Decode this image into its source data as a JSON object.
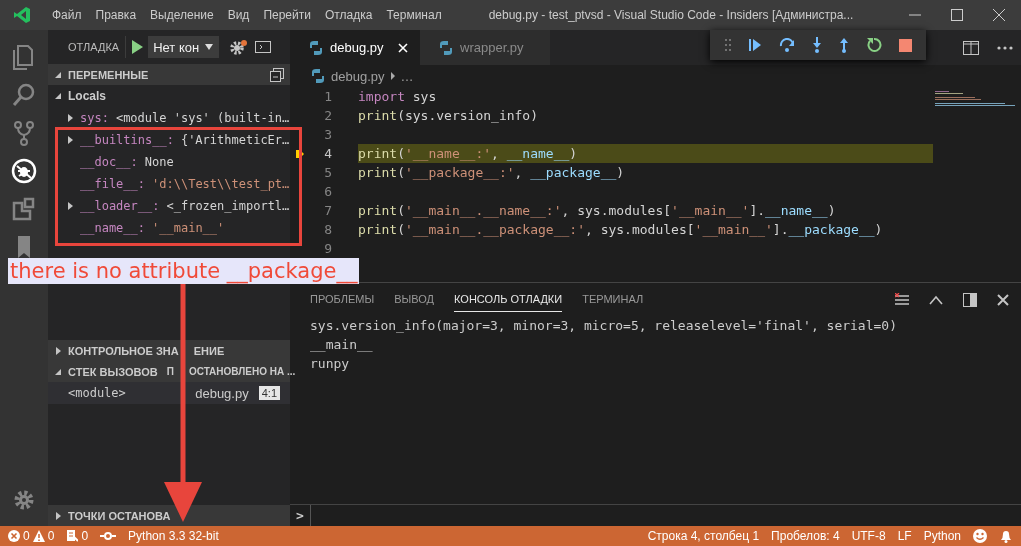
{
  "window": {
    "title": "debug.py - test_ptvsd - Visual Studio Code - Insiders [Администра..."
  },
  "menu": [
    "Файл",
    "Правка",
    "Выделение",
    "Вид",
    "Перейти",
    "Отладка",
    "Терминал"
  ],
  "activity_bar": [
    {
      "kind": "files",
      "selected": false
    },
    {
      "kind": "search",
      "selected": false
    },
    {
      "kind": "scm",
      "selected": false
    },
    {
      "kind": "debug",
      "selected": true
    },
    {
      "kind": "extensions",
      "selected": false
    },
    {
      "kind": "bookmarks",
      "selected": false
    }
  ],
  "debug_header": {
    "title": "ОТЛАДКА",
    "configuration": "Нет кон"
  },
  "variables": {
    "title": "ПЕРЕМЕННЫЕ",
    "expanded": true,
    "scopes": [
      {
        "name": "Locals",
        "expanded": true,
        "children": [
          {
            "name": "sys:",
            "value": "<module 'sys' (built-in…",
            "kind": "object",
            "expandable": true
          },
          {
            "name": "__builtins__:",
            "value": "{'ArithmeticEr…",
            "kind": "object",
            "expandable": true
          },
          {
            "name": "__doc__:",
            "value": "None",
            "kind": "object",
            "expandable": false
          },
          {
            "name": "__file__:",
            "value": "'d:\\\\Test\\\\test_pt…",
            "kind": "string",
            "expandable": false
          },
          {
            "name": "__loader__:",
            "value": "<_frozen_importl…",
            "kind": "object",
            "expandable": true
          },
          {
            "name": "__name__:",
            "value": "'__main__'",
            "kind": "string",
            "expandable": false
          }
        ]
      }
    ]
  },
  "watch": {
    "title_parts": [
      "КОНТРОЛЬНОЕ ЗНА",
      "ЕНИЕ"
    ],
    "expanded": false
  },
  "call_stack": {
    "title": "СТЕК ВЫЗОВОВ",
    "expanded": true,
    "status_parts": [
      "П",
      "ОСТАНОВЛЕНО НА ..."
    ],
    "frames": [
      {
        "name": "<module>",
        "file": "debug.py",
        "position": "4:1"
      }
    ]
  },
  "breakpoints": {
    "title": "ТОЧКИ ОСТАНОВА",
    "expanded": false
  },
  "tabs": [
    {
      "label": "debug.py",
      "selected": true
    },
    {
      "label": "wrapper.py",
      "selected": false
    }
  ],
  "breadcrumb": [
    "debug.py",
    "…"
  ],
  "code": [
    {
      "number": "1",
      "current": false,
      "tokens": [
        {
          "kind": "keyword",
          "text": "import"
        },
        {
          "kind": "plain",
          "text": " sys"
        }
      ]
    },
    {
      "number": "2",
      "current": false,
      "tokens": [
        {
          "kind": "function",
          "text": "print"
        },
        {
          "kind": "plain",
          "text": "(sys.version_info)"
        }
      ]
    },
    {
      "number": "3",
      "current": false
    },
    {
      "number": "4",
      "current": true,
      "tokens": [
        {
          "kind": "function",
          "text": "print"
        },
        {
          "kind": "plain",
          "text": "("
        },
        {
          "kind": "string",
          "text": "'__name__:'"
        },
        {
          "kind": "plain",
          "text": ", "
        },
        {
          "kind": "variable",
          "text": "__name__"
        },
        {
          "kind": "plain",
          "text": ")"
        }
      ]
    },
    {
      "number": "5",
      "current": false,
      "tokens": [
        {
          "kind": "function",
          "text": "print"
        },
        {
          "kind": "plain",
          "text": "("
        },
        {
          "kind": "string",
          "text": "'__package__:'"
        },
        {
          "kind": "plain",
          "text": ", "
        },
        {
          "kind": "variable",
          "text": "__package__"
        },
        {
          "kind": "plain",
          "text": ")"
        }
      ]
    },
    {
      "number": "6",
      "current": false
    },
    {
      "number": "7",
      "current": false,
      "tokens": [
        {
          "kind": "function",
          "text": "print"
        },
        {
          "kind": "plain",
          "text": "("
        },
        {
          "kind": "string",
          "text": "'__main__.__name__:'"
        },
        {
          "kind": "plain",
          "text": ", sys.modules["
        },
        {
          "kind": "string",
          "text": "'__main__'"
        },
        {
          "kind": "plain",
          "text": "]."
        },
        {
          "kind": "variable",
          "text": "__name__"
        },
        {
          "kind": "plain",
          "text": ")"
        }
      ]
    },
    {
      "number": "8",
      "current": false,
      "tokens": [
        {
          "kind": "function",
          "text": "print"
        },
        {
          "kind": "plain",
          "text": "("
        },
        {
          "kind": "string",
          "text": "'__main__.__package__:'"
        },
        {
          "kind": "plain",
          "text": ", sys.modules["
        },
        {
          "kind": "string",
          "text": "'__main__'"
        },
        {
          "kind": "plain",
          "text": "]."
        },
        {
          "kind": "variable",
          "text": "__package__"
        },
        {
          "kind": "plain",
          "text": ")"
        }
      ]
    },
    {
      "number": "9",
      "current": false
    }
  ],
  "panel_tabs": [
    {
      "label": "ПРОБЛЕМЫ",
      "selected": false
    },
    {
      "label": "ВЫВОД",
      "selected": false
    },
    {
      "label": "КОНСОЛЬ ОТЛАДКИ",
      "selected": true
    },
    {
      "label": "ТЕРМИНАЛ",
      "selected": false
    }
  ],
  "console": [
    "sys.version_info(major=3, minor=3, micro=5, releaselevel='final', serial=0)",
    "__main__",
    "runpy"
  ],
  "console_prompt": ">",
  "status_bar": {
    "errors": "0",
    "warnings": "0",
    "info": "0",
    "interpreter": "Python 3.3 32-bit",
    "right": [
      "Строка 4, столбец 1",
      "Пробелов: 4",
      "UTF-8",
      "LF",
      "Python"
    ]
  },
  "annotation": {
    "text": "there is no attribute __package__"
  }
}
